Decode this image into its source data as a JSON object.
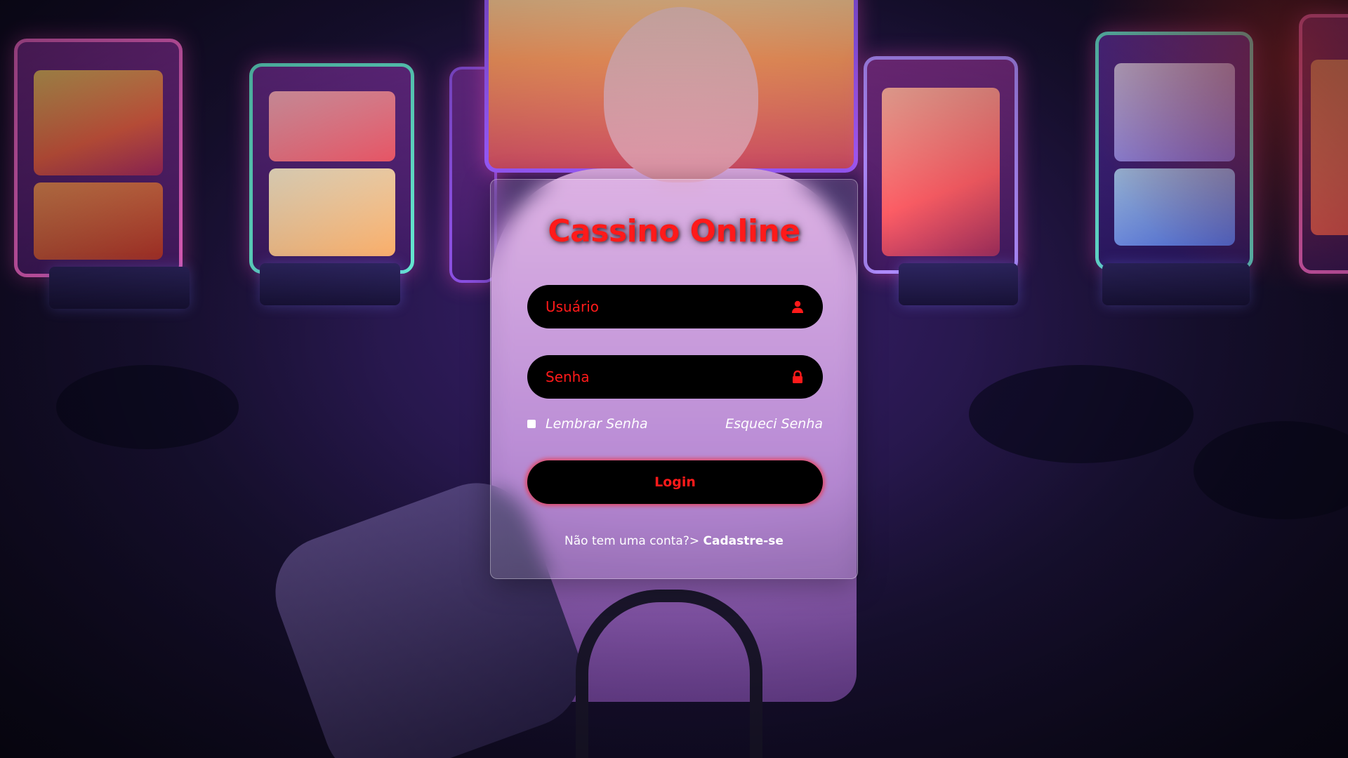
{
  "login": {
    "title": "Cassino Online",
    "username_placeholder": "Usuário",
    "password_placeholder": "Senha",
    "remember_label": "Lembrar Senha",
    "forgot_label": "Esqueci Senha",
    "submit_label": "Login",
    "register_prompt": "Não tem uma conta?>",
    "register_link": "Cadastre-se",
    "icons": {
      "username": "user-icon",
      "password": "lock-icon"
    }
  },
  "colors": {
    "accent": "#ff1a1a",
    "input_background": "#000000",
    "text": "#ffffff"
  }
}
